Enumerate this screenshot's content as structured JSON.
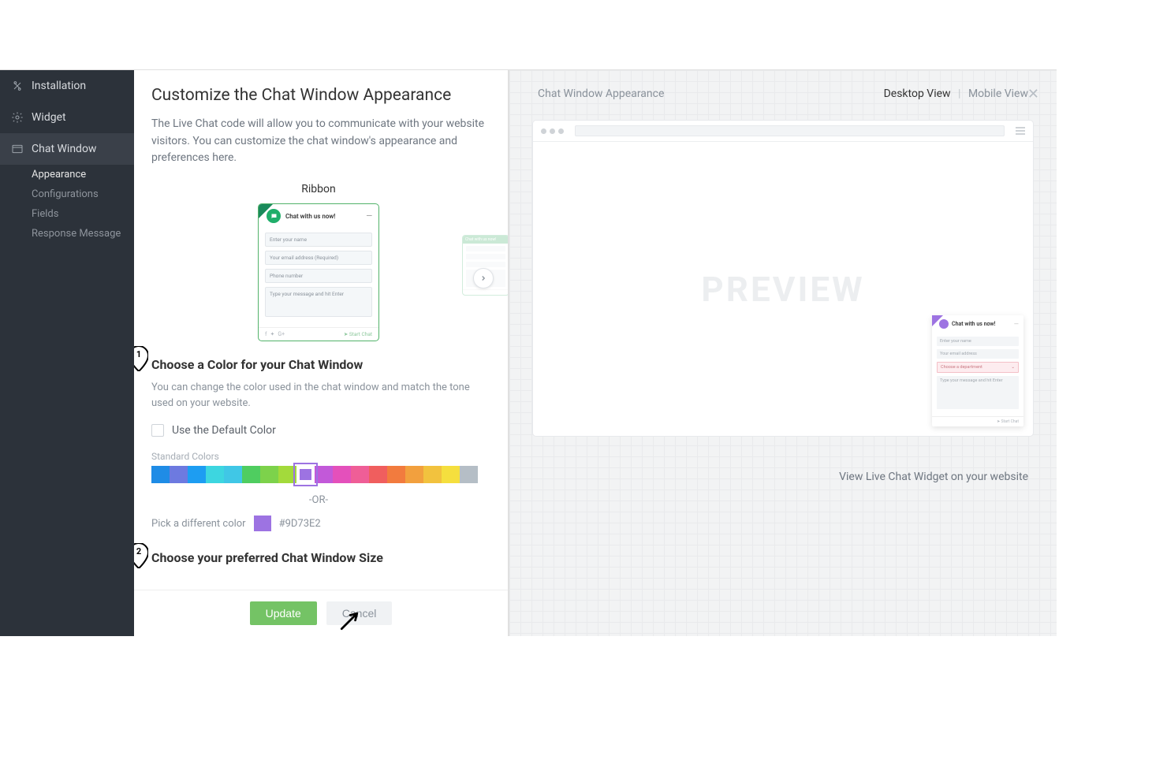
{
  "sidebar": {
    "items": [
      {
        "label": "Installation"
      },
      {
        "label": "Widget"
      },
      {
        "label": "Chat Window"
      }
    ],
    "subitems": [
      {
        "label": "Appearance"
      },
      {
        "label": "Configurations"
      },
      {
        "label": "Fields"
      },
      {
        "label": "Response Message"
      }
    ]
  },
  "page": {
    "title": "Customize the Chat Window Appearance",
    "description": "The Live Chat code will allow you to communicate with your website visitors. You can customize the chat window's appearance and preferences here.",
    "ribbon_label": "Ribbon"
  },
  "ribbon_preview": {
    "title": "Chat with us now!",
    "fields": {
      "name": "Enter your name",
      "email": "Your email address (Required)",
      "phone": "Phone number",
      "message": "Type your message and hit Enter"
    },
    "start": "Start Chat",
    "peek_title": "Chat with us now!"
  },
  "color_section": {
    "title": "Choose a Color for your Chat Window",
    "description": "You can change the color used in the chat window and match the tone used on your website.",
    "default_label": "Use the Default Color",
    "standard_label": "Standard Colors",
    "or": "-OR-",
    "pick_label": "Pick a different color",
    "hex": "#9D73E2",
    "swatches": [
      "#1f8ce6",
      "#6d7ae0",
      "#1d9df2",
      "#3dd6e0",
      "#40c7e6",
      "#4fcd60",
      "#7dd24b",
      "#a3da3b",
      "#9d73e2",
      "#c259d9",
      "#e450bb",
      "#ef5e97",
      "#f05e5e",
      "#f27b3e",
      "#f2a03e",
      "#f2c23e",
      "#f5df3e",
      "#b5bec6"
    ],
    "selected_index": 8
  },
  "size_section": {
    "title": "Choose your preferred Chat Window Size"
  },
  "footer": {
    "update": "Update",
    "cancel": "Cancel"
  },
  "preview": {
    "header": "Chat Window Appearance",
    "desktop": "Desktop View",
    "mobile": "Mobile View",
    "word": "PREVIEW",
    "view_link": "View Live Chat Widget on your website"
  },
  "chat_widget": {
    "title": "Chat with us now!",
    "name": "Enter your name",
    "email": "Your email address",
    "dept": "Choose a department",
    "message": "Type your message and hit Enter",
    "start": "Start Chat"
  },
  "markers": {
    "one": "1",
    "two": "2"
  }
}
